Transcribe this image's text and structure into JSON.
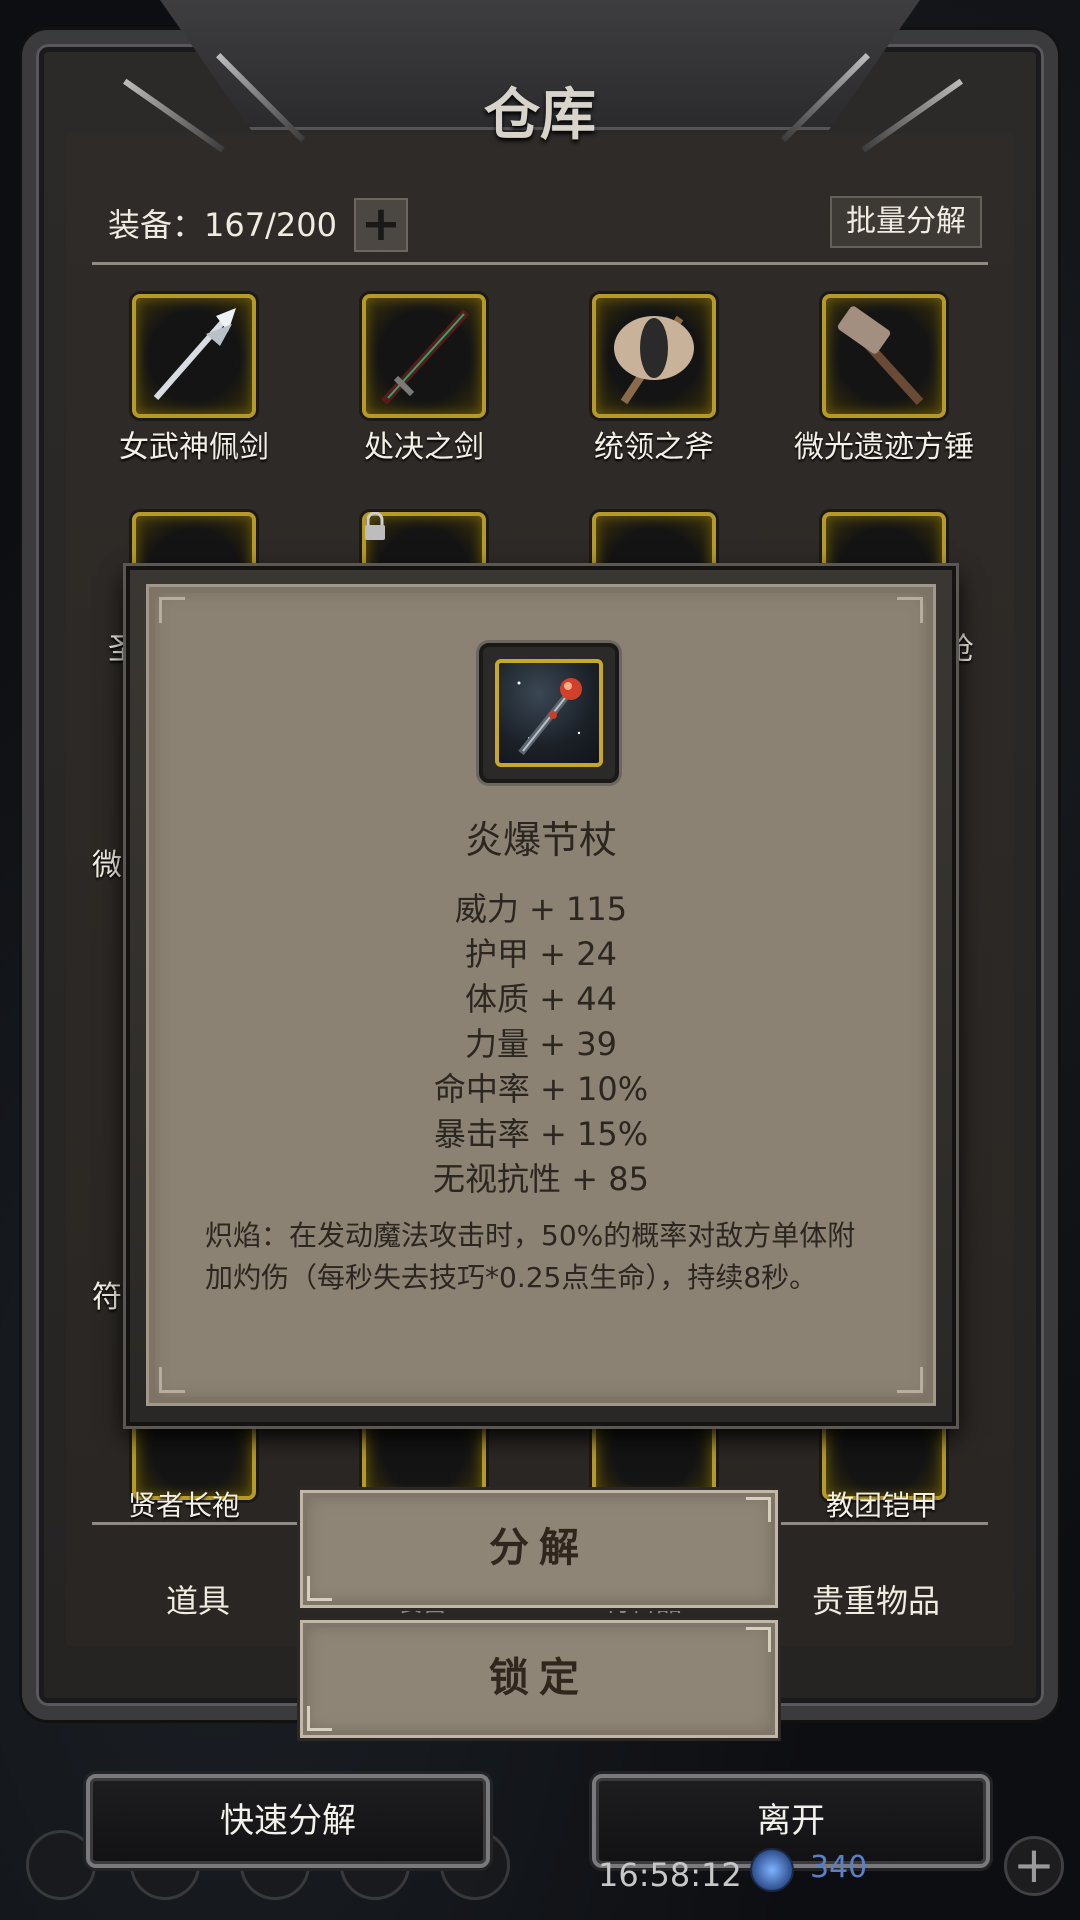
{
  "window": {
    "title": "仓库"
  },
  "header": {
    "equip_count": "装备：167/200",
    "add_label": "+",
    "batch_label": "批量分解"
  },
  "grid_row1": [
    {
      "name": "女武神佩剑",
      "icon": "silver-spear-icon"
    },
    {
      "name": "处决之剑",
      "icon": "dark-sword-icon"
    },
    {
      "name": "统领之斧",
      "icon": "double-axe-icon"
    },
    {
      "name": "微光遗迹方锤",
      "icon": "warhammer-icon"
    }
  ],
  "partial_labels": {
    "r2_left": "圣",
    "r2_right": "枪",
    "r3_left": "微",
    "r5_left": "符",
    "r6_first": "贤者长袍",
    "r6_last": "教团铠甲"
  },
  "tabs": {
    "items": "道具",
    "equipment": "装备",
    "materials": "材料品",
    "valuables": "贵重物品"
  },
  "popup": {
    "title": "炎爆节杖",
    "icon": "flame-scepter-icon",
    "stats": [
      "威力 + 115",
      "护甲 + 24",
      "体质 + 44",
      "力量 + 39",
      "命中率 + 10%",
      "暴击率 + 15%",
      "无视抗性 + 85"
    ],
    "description": "炽焰：在发动魔法攻击时，50%的概率对敌方单体附加灼伤（每秒失去技巧*0.25点生命），持续8秒。"
  },
  "actions": {
    "decompose": "分解",
    "lock": "锁定"
  },
  "bottom": {
    "quick_decompose": "快速分解",
    "leave": "离开",
    "clock": "16:58:12",
    "gems": "340"
  },
  "colors": {
    "slot_border": "#b59a2a",
    "popup_bg": "#8c8273",
    "text_dark": "#2c2620"
  }
}
